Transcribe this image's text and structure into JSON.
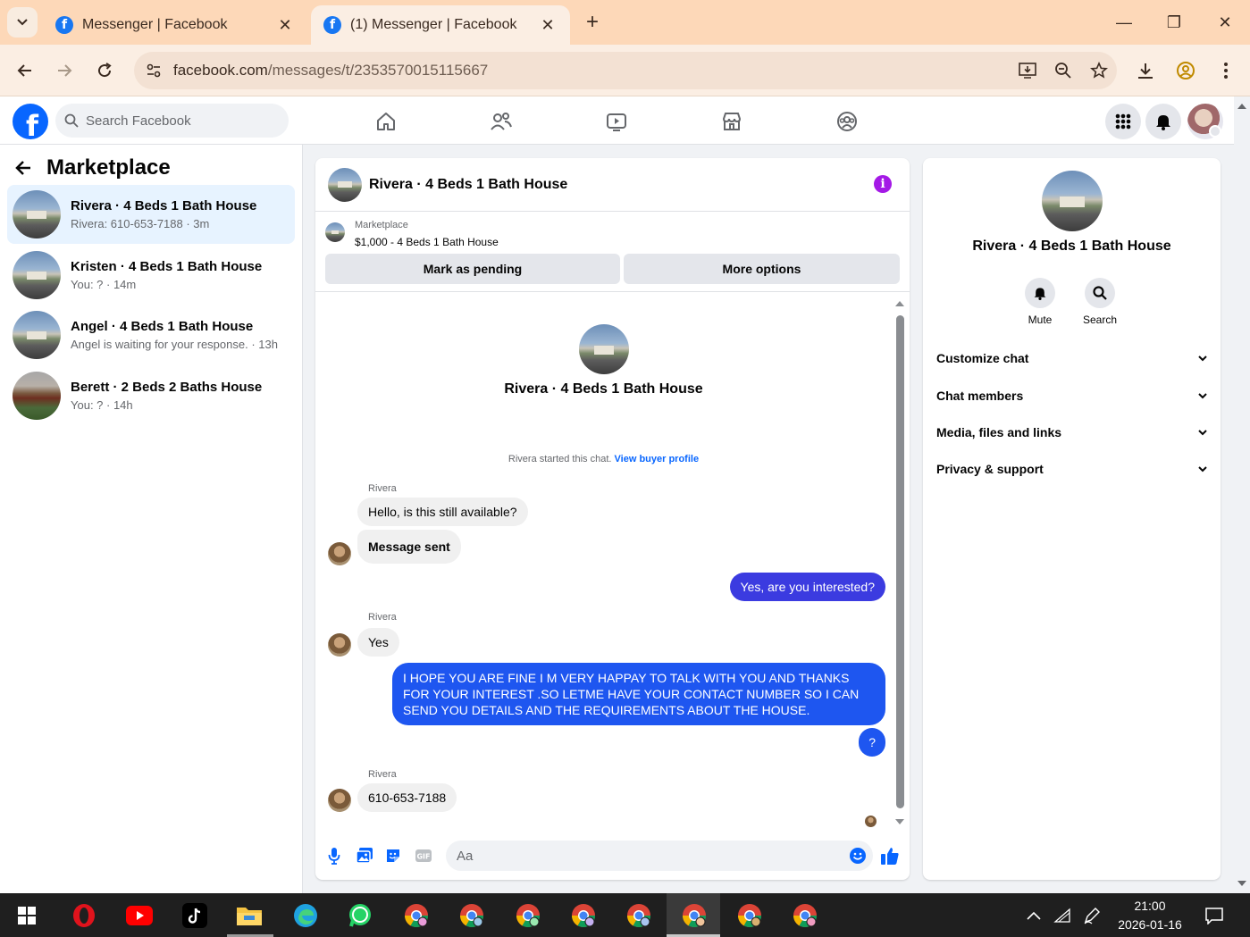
{
  "browser": {
    "tabs": [
      {
        "title": "Messenger | Facebook",
        "active": false
      },
      {
        "title": "(1) Messenger | Facebook",
        "active": true
      }
    ],
    "url_host": "facebook.com",
    "url_path": "/messages/t/2353570015115667"
  },
  "header": {
    "search_placeholder": "Search Facebook",
    "nav_icons": [
      "home-icon",
      "friends-icon",
      "video-icon",
      "marketplace-icon",
      "groups-icon"
    ]
  },
  "sidebar": {
    "title": "Marketplace",
    "conversations": [
      {
        "name": "Rivera · 4 Beds 1 Bath House",
        "preview": "Rivera: 610-653-7188 · 3m",
        "active": true
      },
      {
        "name": "Kristen · 4 Beds 1 Bath House",
        "preview": "You: ? · 14m",
        "active": false
      },
      {
        "name": "Angel · 4 Beds 1 Bath House",
        "preview": "Angel is waiting for your response. · 13h",
        "active": false
      },
      {
        "name": "Berett · 2 Beds 2 Baths House",
        "preview": "You: ? · 14h",
        "active": false
      }
    ]
  },
  "chat": {
    "title": "Rivera · 4 Beds 1 Bath House",
    "listing_label": "Marketplace",
    "listing_price_title": "$1,000 - 4 Beds 1 Bath House",
    "mark_pending_label": "Mark as pending",
    "more_options_label": "More options",
    "intro_name": "Rivera · 4 Beds 1 Bath House",
    "started_text": "Rivera started this chat.",
    "view_profile_label": "View buyer profile",
    "sender_name": "Rivera",
    "messages": [
      "Hello, is this still available?",
      "Message sent",
      "Yes, are you interested?",
      "Yes",
      "I HOPE YOU ARE FINE I M VERY HAPPAY TO TALK WITH YOU AND THANKS FOR YOUR INTEREST .SO LETME HAVE YOUR CONTACT NUMBER SO I CAN SEND YOU DETAILS AND THE REQUIREMENTS ABOUT THE HOUSE.",
      "?",
      "610-653-7188"
    ],
    "composer_placeholder": "Aa"
  },
  "details": {
    "name": "Rivera · 4 Beds 1 Bath House",
    "mute_label": "Mute",
    "search_label": "Search",
    "sections": [
      "Customize chat",
      "Chat members",
      "Media, files and links",
      "Privacy & support"
    ]
  },
  "taskbar": {
    "time": "21:00",
    "date": "2026-01-16"
  },
  "colors": {
    "facebook_blue": "#0866ff",
    "outgoing_bubble": "#3b3be0",
    "info_purple": "#a419e6",
    "tabstrip": "#fdd8b8"
  }
}
